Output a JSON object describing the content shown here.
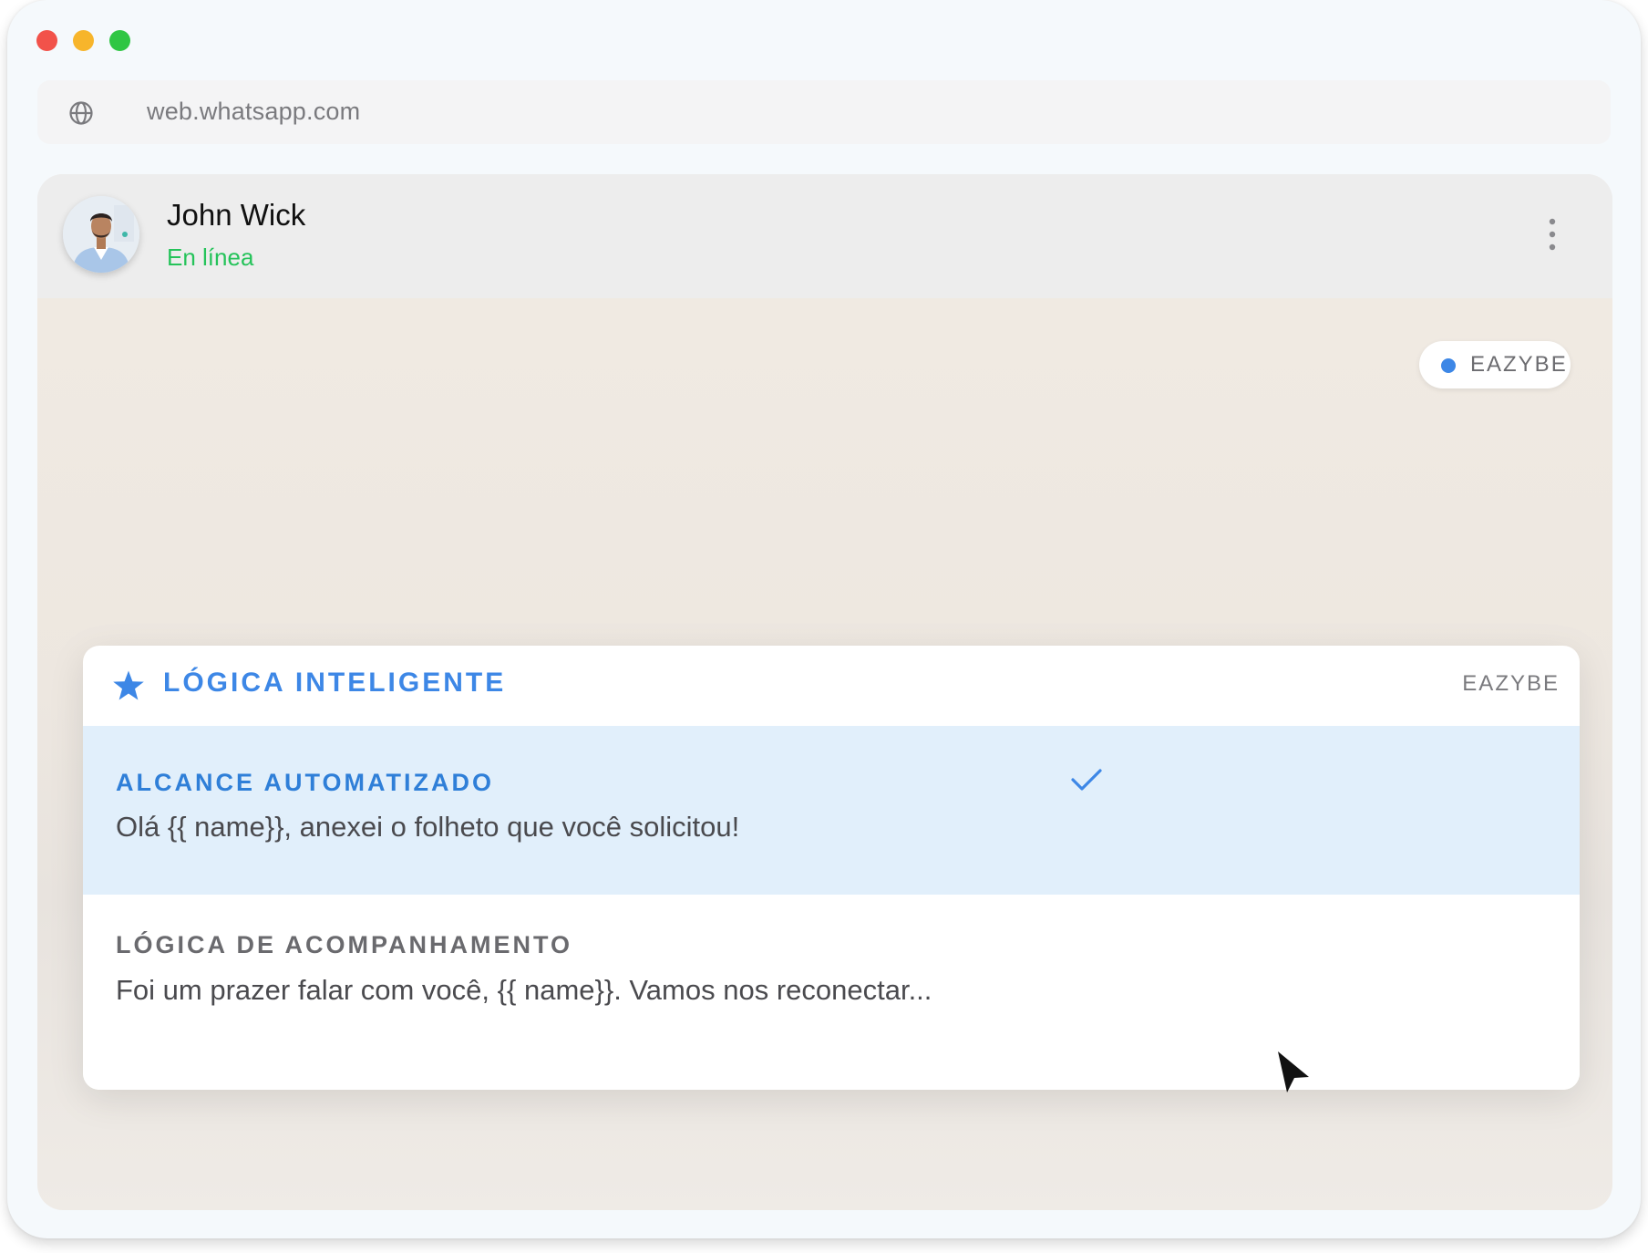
{
  "browser": {
    "url": "web.whatsapp.com"
  },
  "contact": {
    "name": "John Wick",
    "status": "En línea"
  },
  "pill": {
    "label": "EAZYBE"
  },
  "smart_card": {
    "title": "LÓGICA INTELIGENTE",
    "brand": "EAZYBE",
    "options": [
      {
        "title": "ALCANCE AUTOMATIZADO",
        "body": "Olá {{ name}}, anexei o folheto que você solicitou!",
        "selected": true
      },
      {
        "title": "LÓGICA DE ACOMPANHAMENTO",
        "body": "Foi um prazer falar com você, {{ name}}. Vamos nos reconectar...",
        "selected": false
      }
    ]
  },
  "colors": {
    "accent": "#3d87e6",
    "online": "#25c35a",
    "selected_row": "#e1effb"
  },
  "icons": [
    "globe-icon",
    "more-vertical-icon",
    "star-icon",
    "check-icon",
    "cursor-icon"
  ]
}
